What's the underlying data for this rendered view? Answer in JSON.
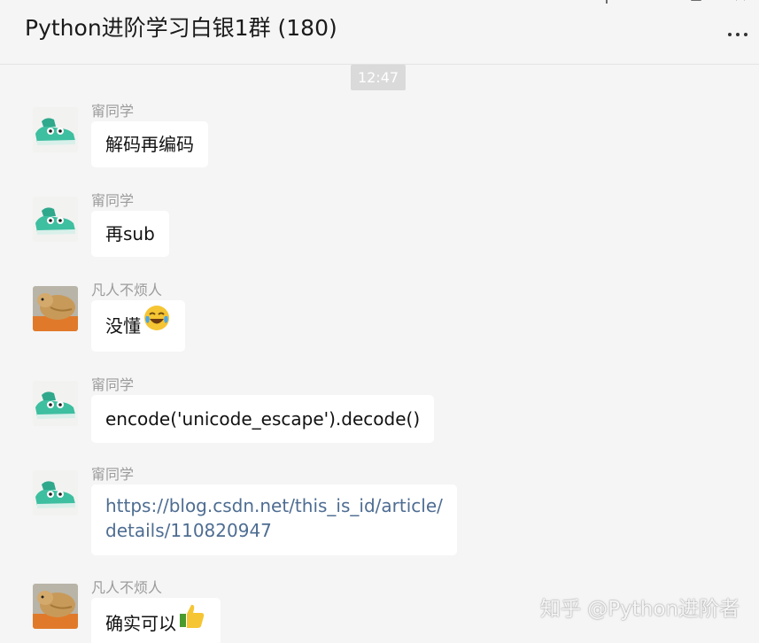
{
  "window": {
    "title": "Python进阶学习白银1群 (180)",
    "controls": {
      "pin": "pin-icon",
      "minimize": "minimize-icon",
      "maximize": "maximize-icon",
      "close": "close-icon"
    },
    "more_menu": "more-icon"
  },
  "chat": {
    "timestamp": "12:47",
    "messages": [
      {
        "sender": "甯同学",
        "avatar": "shoe-avatar",
        "text": "解码再编码"
      },
      {
        "sender": "甯同学",
        "avatar": "shoe-avatar",
        "text": "再sub"
      },
      {
        "sender": "凡人不烦人",
        "avatar": "dog-avatar",
        "text": "没懂",
        "emoji": "laughing-crying-emoji"
      },
      {
        "sender": "甯同学",
        "avatar": "shoe-avatar",
        "text": "encode('unicode_escape').decode()"
      },
      {
        "sender": "甯同学",
        "avatar": "shoe-avatar",
        "link_line1": "https://blog.csdn.net/this_is_id/article/",
        "link_line2": "details/110820947"
      },
      {
        "sender": "凡人不烦人",
        "avatar": "dog-avatar",
        "text": "确实可以",
        "emoji": "thumbs-up-emoji"
      }
    ]
  },
  "watermark": "知乎 @Python进阶者",
  "colors": {
    "background": "#f5f5f5",
    "bubble": "#ffffff",
    "sender_name": "#9b9b9b",
    "link": "#4e6d92",
    "timestamp_bg": "#dadada"
  }
}
